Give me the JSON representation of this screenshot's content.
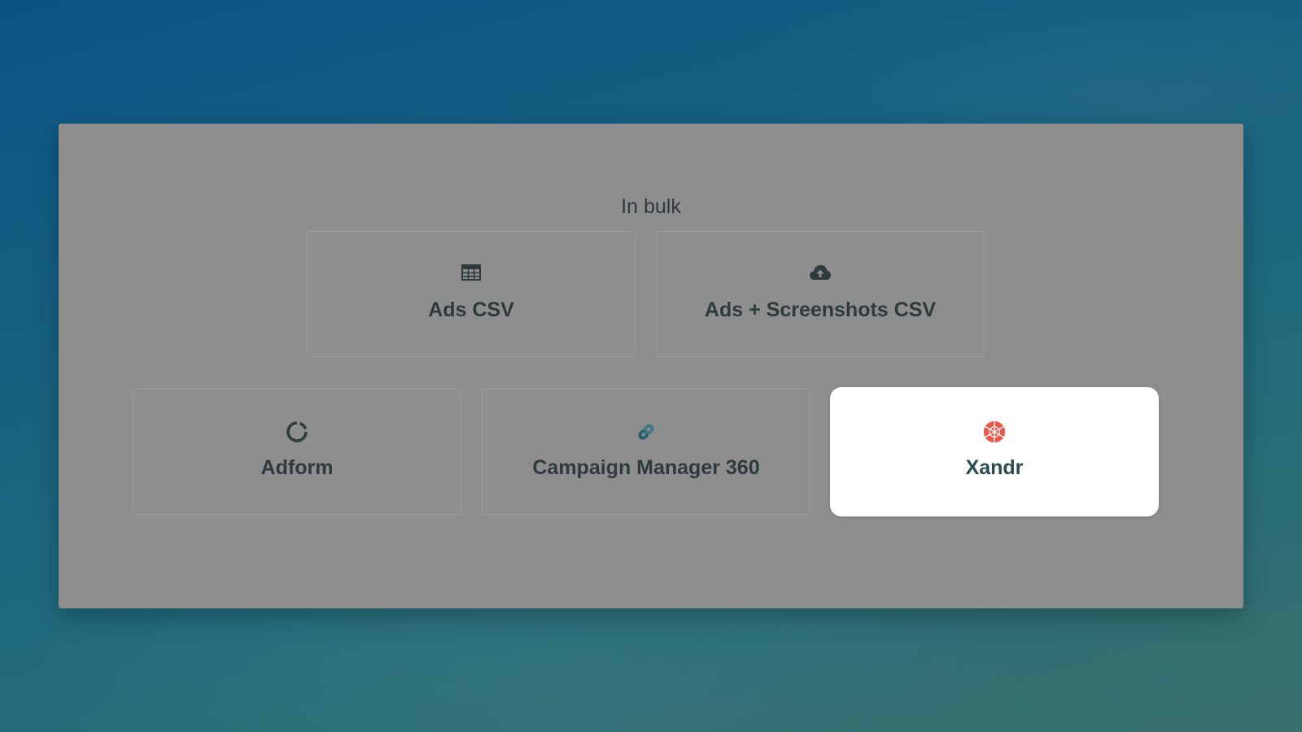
{
  "section": {
    "title": "In bulk"
  },
  "options": {
    "ads_csv": {
      "label": "Ads CSV",
      "icon": "table-icon"
    },
    "ads_screenshots_csv": {
      "label": "Ads + Screenshots CSV",
      "icon": "cloud-upload-icon"
    },
    "adform": {
      "label": "Adform",
      "icon": "adform-logo-icon"
    },
    "campaign_manager": {
      "label": "Campaign Manager 360",
      "icon": "campaign-manager-logo-icon"
    },
    "xandr": {
      "label": "Xandr",
      "icon": "xandr-logo-icon",
      "selected": true
    }
  },
  "colors": {
    "text": "#2e3a3c",
    "overlay": "#8e8e8e",
    "selected_card": "#ffffff",
    "xandr_accent": "#e8574a",
    "cm_accent": "#2a5c6a"
  }
}
